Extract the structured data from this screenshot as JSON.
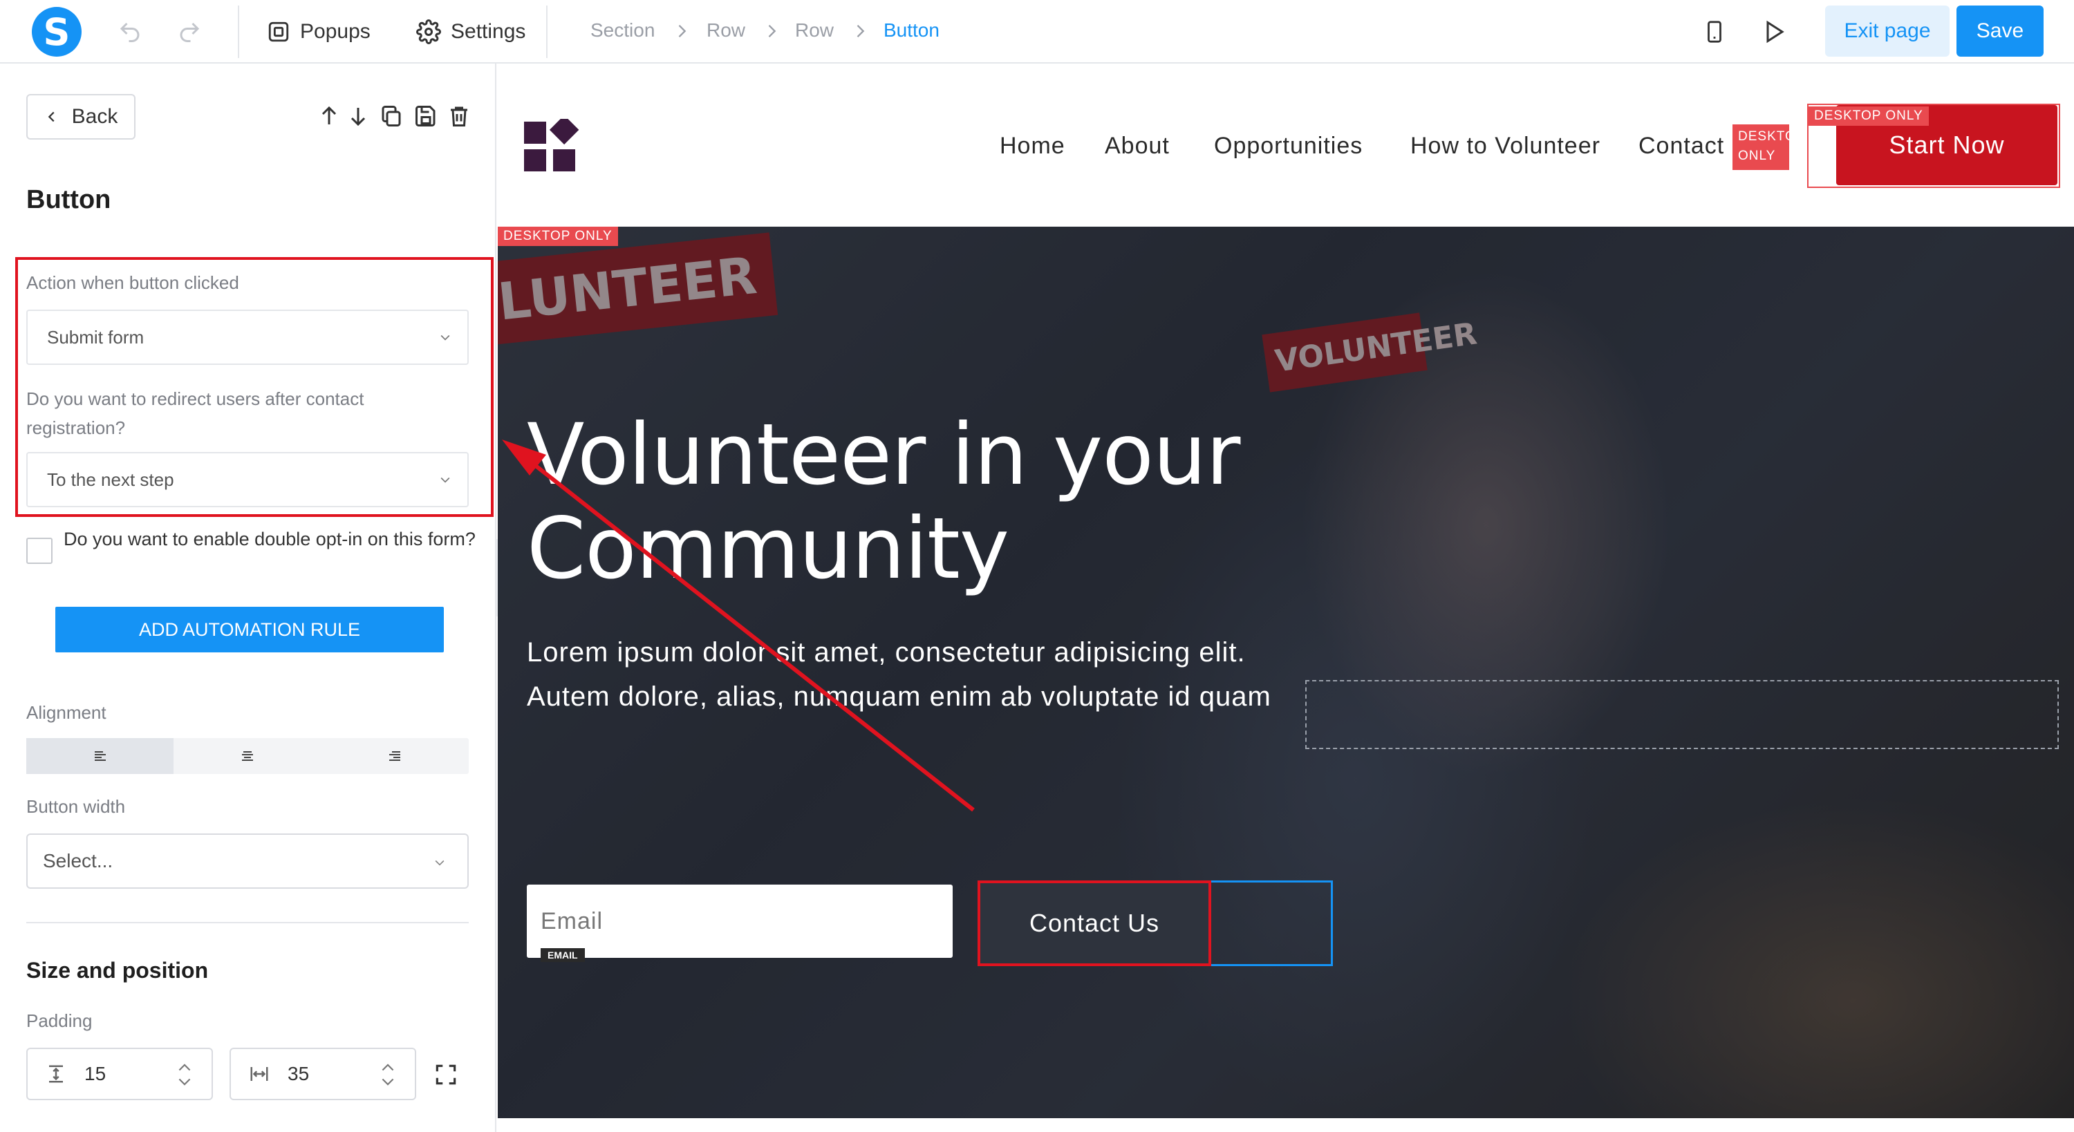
{
  "toolbar": {
    "logo_letter": "S",
    "popups_label": "Popups",
    "settings_label": "Settings",
    "breadcrumb": [
      "Section",
      "Row",
      "Row",
      "Button"
    ],
    "exit_label": "Exit page",
    "save_label": "Save"
  },
  "panel": {
    "back_label": "Back",
    "title": "Button",
    "action_label": "Action when button clicked",
    "action_value": "Submit form",
    "redirect_label": "Do you want to redirect users after contact registration?",
    "redirect_value": "To the next step",
    "double_optin_label": "Do you want to enable double opt-in on this form?",
    "add_rule_label": "ADD AUTOMATION RULE",
    "alignment_label": "Alignment",
    "button_width_label": "Button width",
    "button_width_placeholder": "Select...",
    "size_position_label": "Size and position",
    "padding_label": "Padding",
    "padding_vertical": "15",
    "padding_horizontal": "35"
  },
  "site": {
    "nav": [
      "Home",
      "About",
      "Opportunities",
      "How to Volunteer",
      "Contact"
    ],
    "desktop_only_badge": "DESKTOP ONLY",
    "desktop_badge_line1": "DESKTOP",
    "desktop_badge_line2": "ONLY",
    "start_label": "Start Now",
    "hero_title_line1": "Volunteer in your",
    "hero_title_line2": "Community",
    "hero_text": "Lorem ipsum dolor sit amet, consectetur adipisicing elit. Autem dolore, alias, numquam enim ab voluptate id quam",
    "email_placeholder": "Email",
    "email_tag": "EMAIL",
    "contact_label": "Contact Us",
    "sign_text_1": "LUNTEER",
    "sign_text_2": "VOLUNTEER"
  },
  "colors": {
    "accent": "#1593f5",
    "highlight": "#e0131f",
    "brand_dark": "#3b1a3e",
    "cta_red": "#c8141f"
  }
}
